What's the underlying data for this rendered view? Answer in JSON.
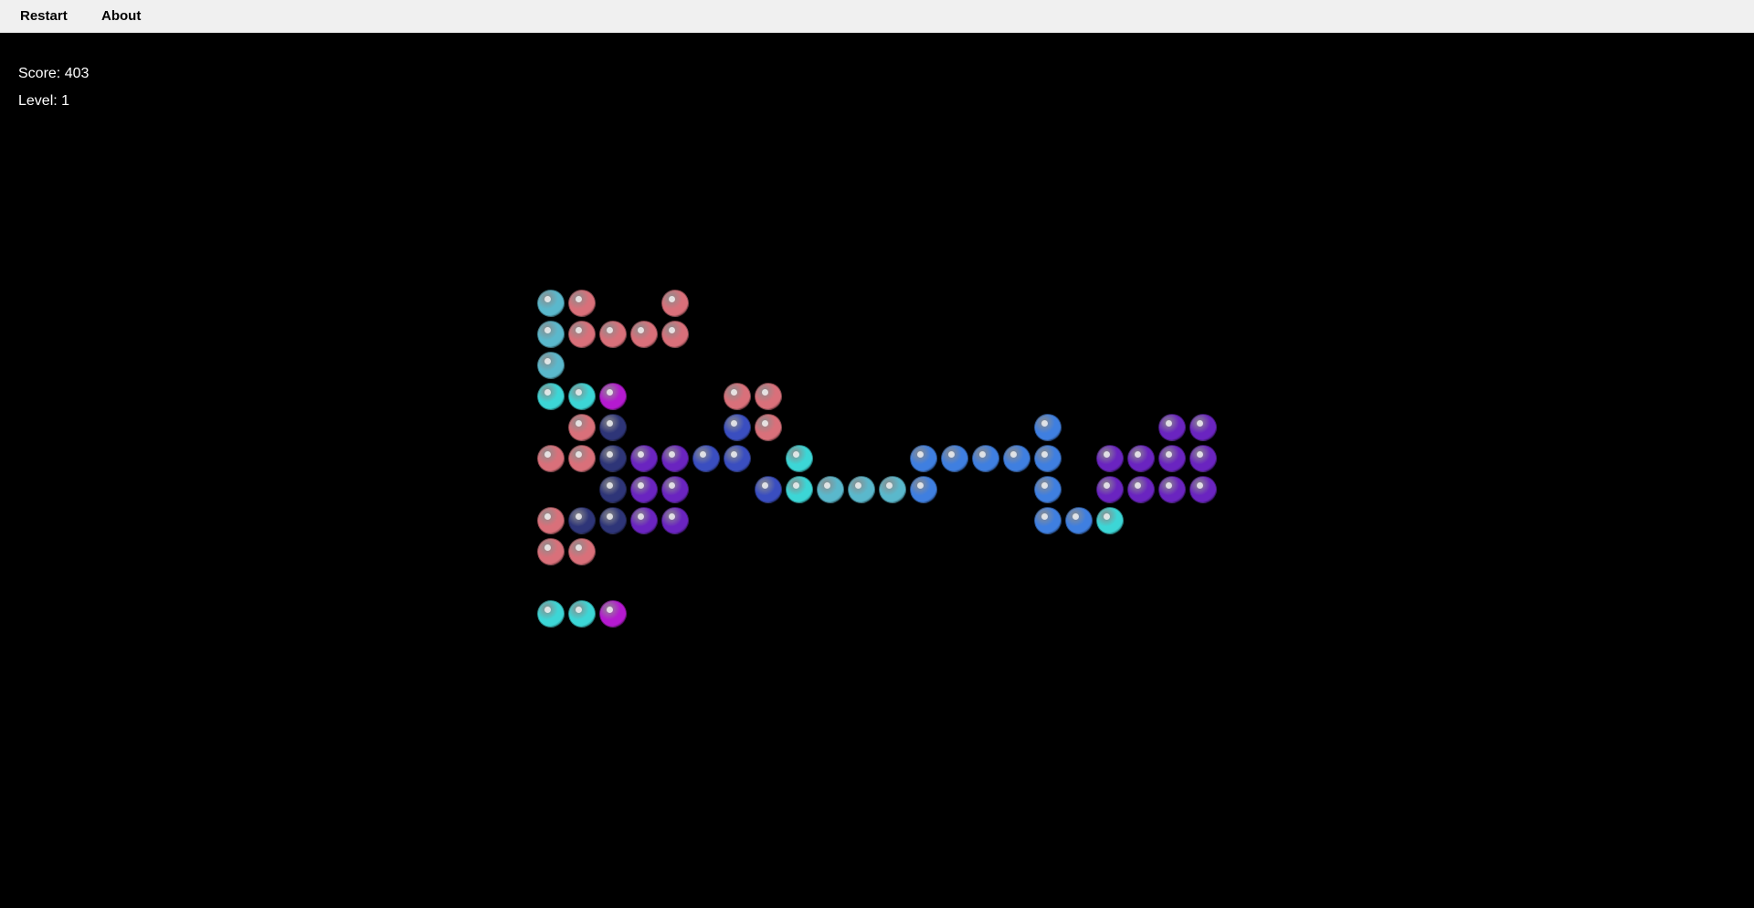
{
  "menu": {
    "restart_label": "Restart",
    "about_label": "About"
  },
  "status": {
    "score_text": "Score: 403",
    "level_text": "Level: 1"
  },
  "palette": {
    "pink": "#d9707a",
    "lightblue": "#5ab8cc",
    "cyan": "#3cd6d6",
    "magenta": "#b51ad0",
    "navy": "#2e3578",
    "purple": "#6a24c0",
    "royal": "#3a4ec0",
    "blue": "#3f7fe0"
  },
  "board": {
    "columns": 22,
    "rows": 11,
    "balls": [
      {
        "col": 0,
        "row": 0,
        "color": "lightblue"
      },
      {
        "col": 1,
        "row": 0,
        "color": "pink"
      },
      {
        "col": 4,
        "row": 0,
        "color": "pink"
      },
      {
        "col": 0,
        "row": 1,
        "color": "lightblue"
      },
      {
        "col": 1,
        "row": 1,
        "color": "pink"
      },
      {
        "col": 2,
        "row": 1,
        "color": "pink"
      },
      {
        "col": 3,
        "row": 1,
        "color": "pink"
      },
      {
        "col": 4,
        "row": 1,
        "color": "pink"
      },
      {
        "col": 0,
        "row": 2,
        "color": "lightblue"
      },
      {
        "col": 0,
        "row": 3,
        "color": "cyan"
      },
      {
        "col": 1,
        "row": 3,
        "color": "cyan"
      },
      {
        "col": 2,
        "row": 3,
        "color": "magenta"
      },
      {
        "col": 6,
        "row": 3,
        "color": "pink"
      },
      {
        "col": 7,
        "row": 3,
        "color": "pink"
      },
      {
        "col": 1,
        "row": 4,
        "color": "pink"
      },
      {
        "col": 2,
        "row": 4,
        "color": "navy"
      },
      {
        "col": 6,
        "row": 4,
        "color": "royal"
      },
      {
        "col": 7,
        "row": 4,
        "color": "pink"
      },
      {
        "col": 16,
        "row": 4,
        "color": "blue"
      },
      {
        "col": 20,
        "row": 4,
        "color": "purple"
      },
      {
        "col": 21,
        "row": 4,
        "color": "purple"
      },
      {
        "col": 0,
        "row": 5,
        "color": "pink"
      },
      {
        "col": 1,
        "row": 5,
        "color": "pink"
      },
      {
        "col": 2,
        "row": 5,
        "color": "navy"
      },
      {
        "col": 3,
        "row": 5,
        "color": "purple"
      },
      {
        "col": 4,
        "row": 5,
        "color": "purple"
      },
      {
        "col": 5,
        "row": 5,
        "color": "royal"
      },
      {
        "col": 6,
        "row": 5,
        "color": "royal"
      },
      {
        "col": 8,
        "row": 5,
        "color": "cyan"
      },
      {
        "col": 12,
        "row": 5,
        "color": "blue"
      },
      {
        "col": 13,
        "row": 5,
        "color": "blue"
      },
      {
        "col": 14,
        "row": 5,
        "color": "blue"
      },
      {
        "col": 15,
        "row": 5,
        "color": "blue"
      },
      {
        "col": 16,
        "row": 5,
        "color": "blue"
      },
      {
        "col": 18,
        "row": 5,
        "color": "purple"
      },
      {
        "col": 19,
        "row": 5,
        "color": "purple"
      },
      {
        "col": 20,
        "row": 5,
        "color": "purple"
      },
      {
        "col": 21,
        "row": 5,
        "color": "purple"
      },
      {
        "col": 2,
        "row": 6,
        "color": "navy"
      },
      {
        "col": 3,
        "row": 6,
        "color": "purple"
      },
      {
        "col": 4,
        "row": 6,
        "color": "purple"
      },
      {
        "col": 7,
        "row": 6,
        "color": "royal"
      },
      {
        "col": 8,
        "row": 6,
        "color": "cyan"
      },
      {
        "col": 9,
        "row": 6,
        "color": "lightblue"
      },
      {
        "col": 10,
        "row": 6,
        "color": "lightblue"
      },
      {
        "col": 11,
        "row": 6,
        "color": "lightblue"
      },
      {
        "col": 12,
        "row": 6,
        "color": "blue"
      },
      {
        "col": 16,
        "row": 6,
        "color": "blue"
      },
      {
        "col": 18,
        "row": 6,
        "color": "purple"
      },
      {
        "col": 19,
        "row": 6,
        "color": "purple"
      },
      {
        "col": 20,
        "row": 6,
        "color": "purple"
      },
      {
        "col": 21,
        "row": 6,
        "color": "purple"
      },
      {
        "col": 0,
        "row": 7,
        "color": "pink"
      },
      {
        "col": 1,
        "row": 7,
        "color": "navy"
      },
      {
        "col": 2,
        "row": 7,
        "color": "navy"
      },
      {
        "col": 3,
        "row": 7,
        "color": "purple"
      },
      {
        "col": 4,
        "row": 7,
        "color": "purple"
      },
      {
        "col": 16,
        "row": 7,
        "color": "blue"
      },
      {
        "col": 17,
        "row": 7,
        "color": "blue"
      },
      {
        "col": 18,
        "row": 7,
        "color": "cyan"
      },
      {
        "col": 0,
        "row": 8,
        "color": "pink"
      },
      {
        "col": 1,
        "row": 8,
        "color": "pink"
      }
    ]
  },
  "next_balls": [
    "cyan",
    "cyan",
    "magenta"
  ]
}
